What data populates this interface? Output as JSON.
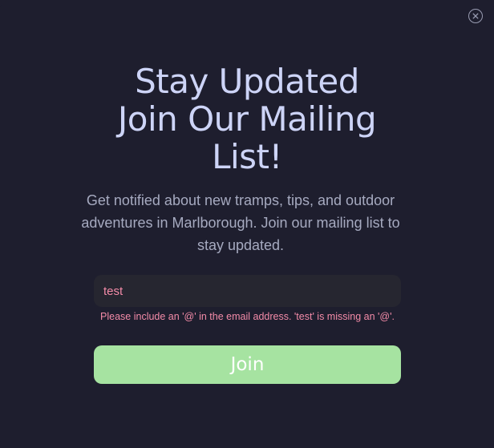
{
  "modal": {
    "close_icon": "close-icon",
    "title_lines": [
      "Stay Updated",
      "Join Our Mailing",
      "List!"
    ],
    "subtitle": "Get notified about new tramps, tips, and outdoor adventures in Marlborough. Join our mailing list to stay updated.",
    "email": {
      "value": "test",
      "validation_message": "Please include an '@' in the email address. 'test' is missing an '@'."
    },
    "join_label": "Join"
  },
  "colors": {
    "background": "#1e1e2e",
    "title": "#cdd4f7",
    "subtitle": "#a6aac0",
    "input_background": "#262630",
    "error": "#f38ba8",
    "button": "#a6e3a1",
    "button_text": "#ffffff"
  }
}
